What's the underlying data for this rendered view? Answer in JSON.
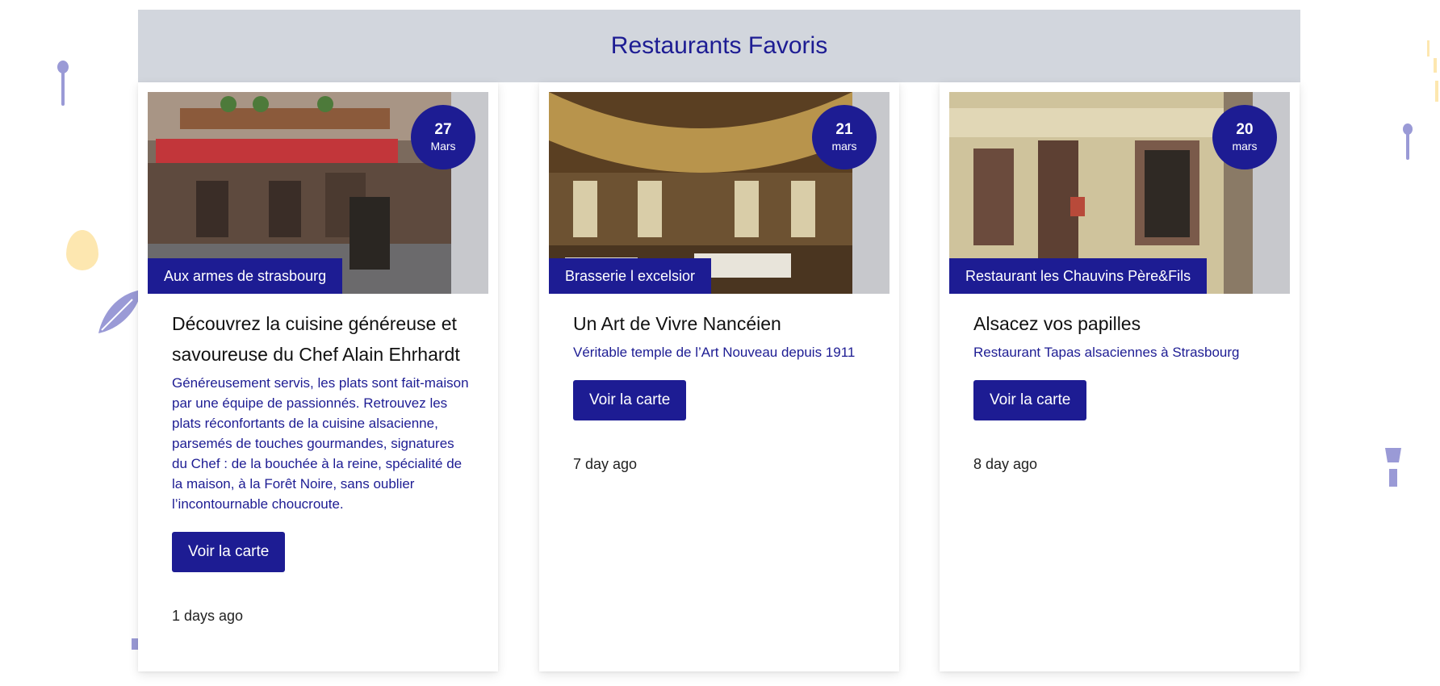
{
  "page": {
    "title": "Restaurants Favoris"
  },
  "colors": {
    "accent": "#1d1c93",
    "header_bg": "#d2d6dd",
    "image_bg": "#c7c8cc"
  },
  "cards": [
    {
      "tag": "Aux armes de strasbourg",
      "day": "27",
      "month": "Mars",
      "title": "Découvrez la cuisine généreuse et savoureuse du Chef Alain Ehrhardt",
      "description": "Généreusement servis, les plats sont fait-maison par une équipe de passionnés. Retrouvez les plats réconfortants de la cuisine alsacienne, parsemés de touches gourmandes, signatures du Chef : de la bouchée à la reine, spécialité de la maison, à la Forêt Noire, sans oublier l’incontournable choucroute.",
      "button": "Voir la carte",
      "ago": "1 days ago",
      "image_icon": "restaurant-facade-photo"
    },
    {
      "tag": "Brasserie l excelsior",
      "day": "21",
      "month": "mars",
      "title": "Un Art de Vivre Nancéien",
      "description": "Véritable temple de l’Art Nouveau depuis 1911",
      "button": "Voir la carte",
      "ago": "7 day ago",
      "image_icon": "brasserie-interior-photo"
    },
    {
      "tag": "Restaurant les Chauvins Père&Fils",
      "day": "20",
      "month": "mars",
      "title": "Alsacez vos papilles",
      "description": "Restaurant Tapas alsaciennes à Strasbourg",
      "button": "Voir la carte",
      "ago": "8 day ago",
      "image_icon": "restaurant-storefront-photo"
    }
  ]
}
